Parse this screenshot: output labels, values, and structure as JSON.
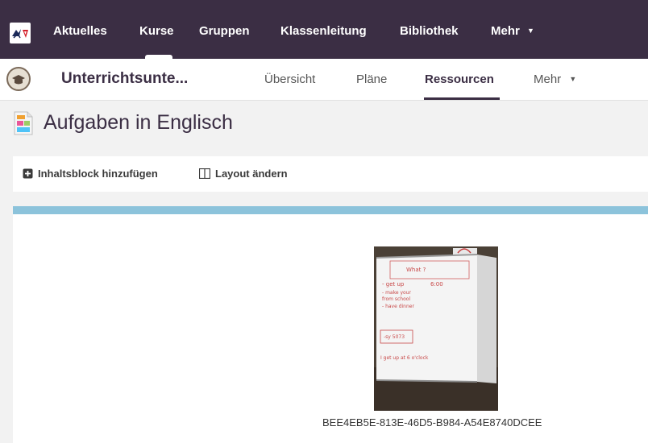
{
  "topnav": {
    "items": [
      {
        "label": "Aktuelles"
      },
      {
        "label": "Kurse"
      },
      {
        "label": "Gruppen"
      },
      {
        "label": "Klassenleitung"
      },
      {
        "label": "Bibliothek"
      },
      {
        "label": "Mehr"
      }
    ]
  },
  "subnav": {
    "course_title": "Unterrichtsunte...",
    "items": [
      {
        "label": "Übersicht"
      },
      {
        "label": "Pläne"
      },
      {
        "label": "Ressourcen"
      },
      {
        "label": "Mehr"
      }
    ]
  },
  "page": {
    "title": "Aufgaben in Englisch"
  },
  "toolbar": {
    "add_block_label": "Inhaltsblock hinzufügen",
    "change_layout_label": "Layout ändern"
  },
  "content": {
    "image_caption": "BEE4EB5E-813E-46D5-B984-A54E8740DCEE",
    "whiteboard_lines": [
      "What ?",
      "- get up",
      "6:00",
      "- make your",
      "from school",
      "- have dinner",
      "-sy 5073",
      "I get up at 6 o'clock"
    ]
  },
  "colors": {
    "nav_background": "#3b2e44",
    "accent_bar": "#8cc3db"
  }
}
